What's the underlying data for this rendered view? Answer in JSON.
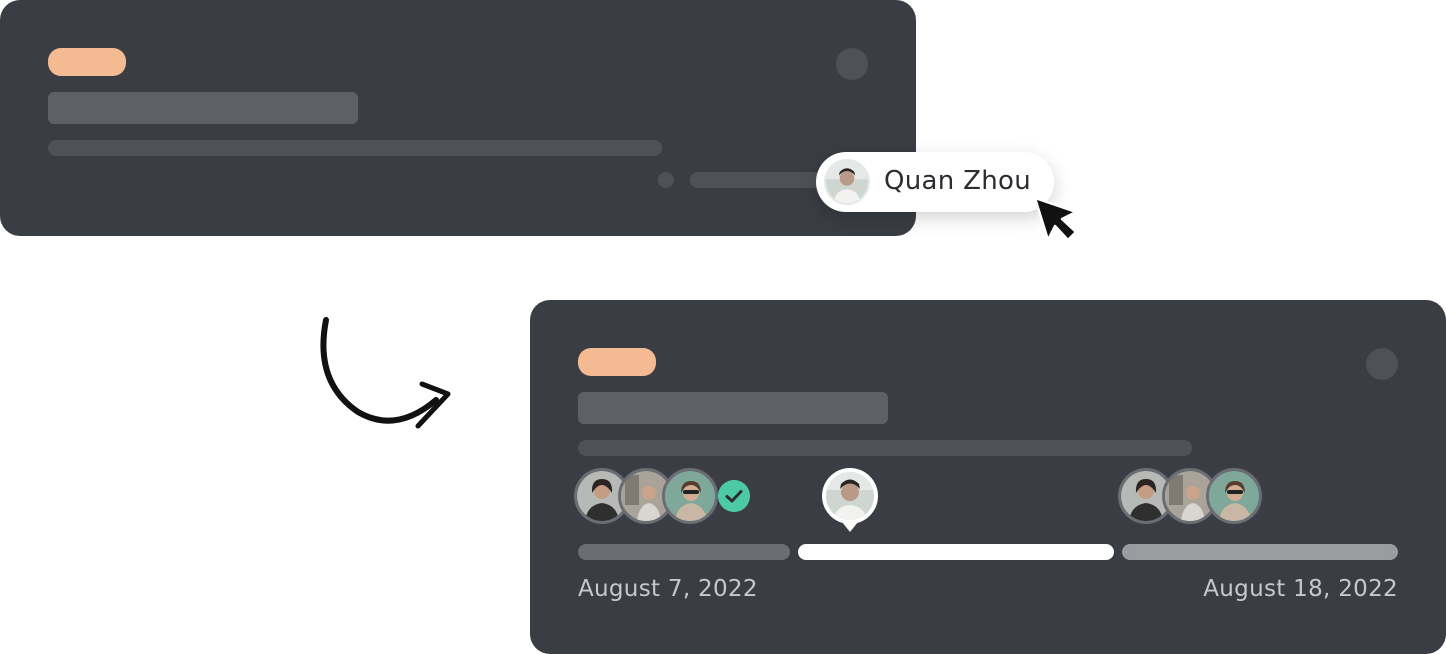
{
  "popover": {
    "user_name": "Quan Zhou"
  },
  "timeline": {
    "start_date": "August 7, 2022",
    "end_date": "August 18, 2022",
    "segments": [
      {
        "state": "done",
        "color": "#6a6d73"
      },
      {
        "state": "current",
        "color": "#ffffff"
      },
      {
        "state": "upcoming",
        "color": "#9a9ca0"
      }
    ]
  },
  "colors": {
    "card_bg": "#3a3d43",
    "tag": "#f4bb93",
    "check": "#4ec9a8"
  },
  "icons": {
    "cursor": "pointer-cursor-icon",
    "check": "check-circle-icon",
    "arrow": "curved-arrow-icon"
  }
}
